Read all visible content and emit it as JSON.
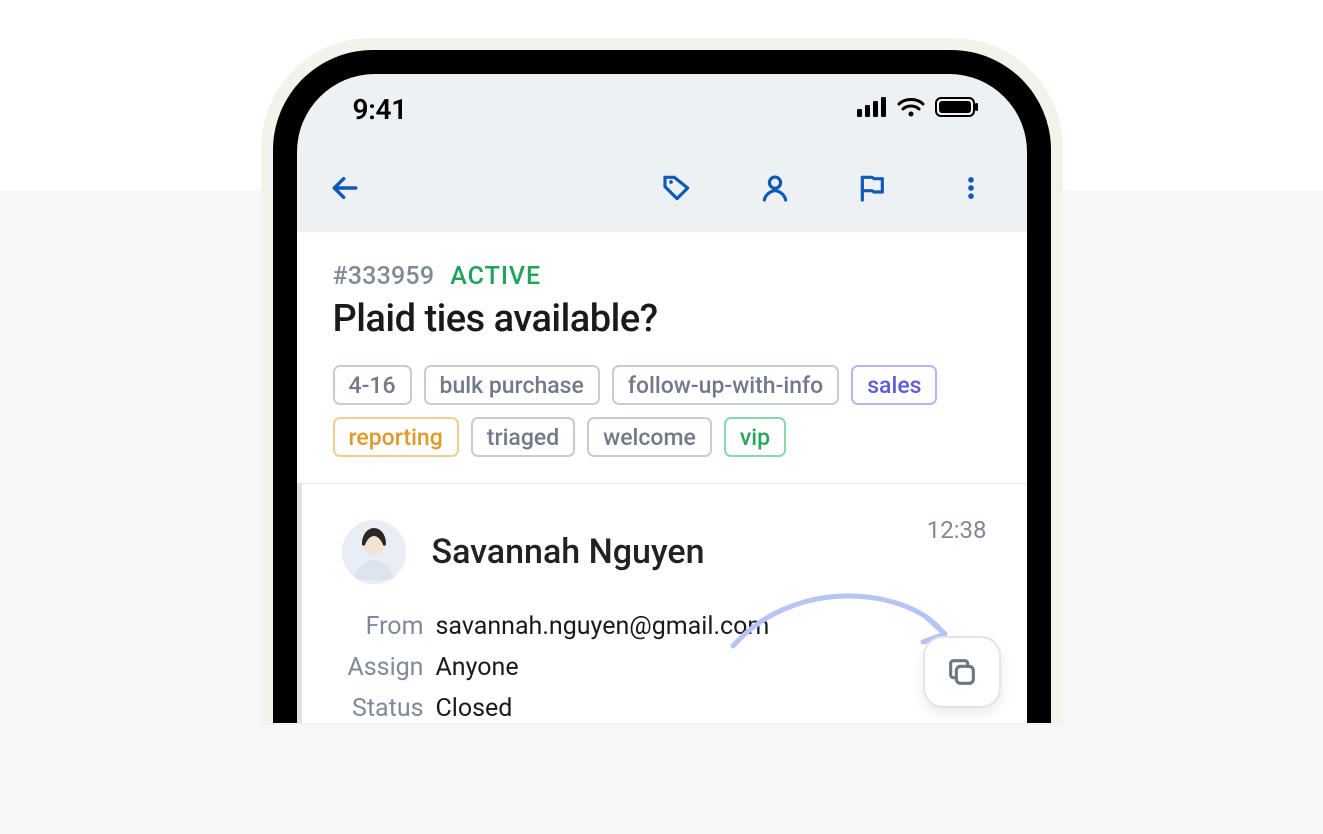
{
  "statusbar": {
    "time": "9:41"
  },
  "toolbar": {
    "back_icon_name": "arrow-left-icon",
    "actions": [
      {
        "name": "tag-icon"
      },
      {
        "name": "person-icon"
      },
      {
        "name": "flag-icon"
      },
      {
        "name": "more-vertical-icon"
      }
    ]
  },
  "ticket": {
    "id": "#333959",
    "status": "ACTIVE",
    "title": "Plaid ties available?",
    "tags": [
      {
        "label": "4-16",
        "variant": "gray"
      },
      {
        "label": "bulk purchase",
        "variant": "gray"
      },
      {
        "label": "follow-up-with-info",
        "variant": "gray"
      },
      {
        "label": "sales",
        "variant": "purple"
      },
      {
        "label": "reporting",
        "variant": "orange"
      },
      {
        "label": "triaged",
        "variant": "gray"
      },
      {
        "label": "welcome",
        "variant": "gray"
      },
      {
        "label": "vip",
        "variant": "green"
      }
    ]
  },
  "message": {
    "sender_name": "Savannah Nguyen",
    "time": "12:38",
    "meta": {
      "from_label": "From",
      "from_value": "savannah.nguyen@gmail.com",
      "assign_label": "Assign",
      "assign_value": "Anyone",
      "status_label": "Status",
      "status_value": "Closed"
    }
  },
  "colors": {
    "primary": "#0f59b9",
    "status_active": "#1fa25a"
  }
}
